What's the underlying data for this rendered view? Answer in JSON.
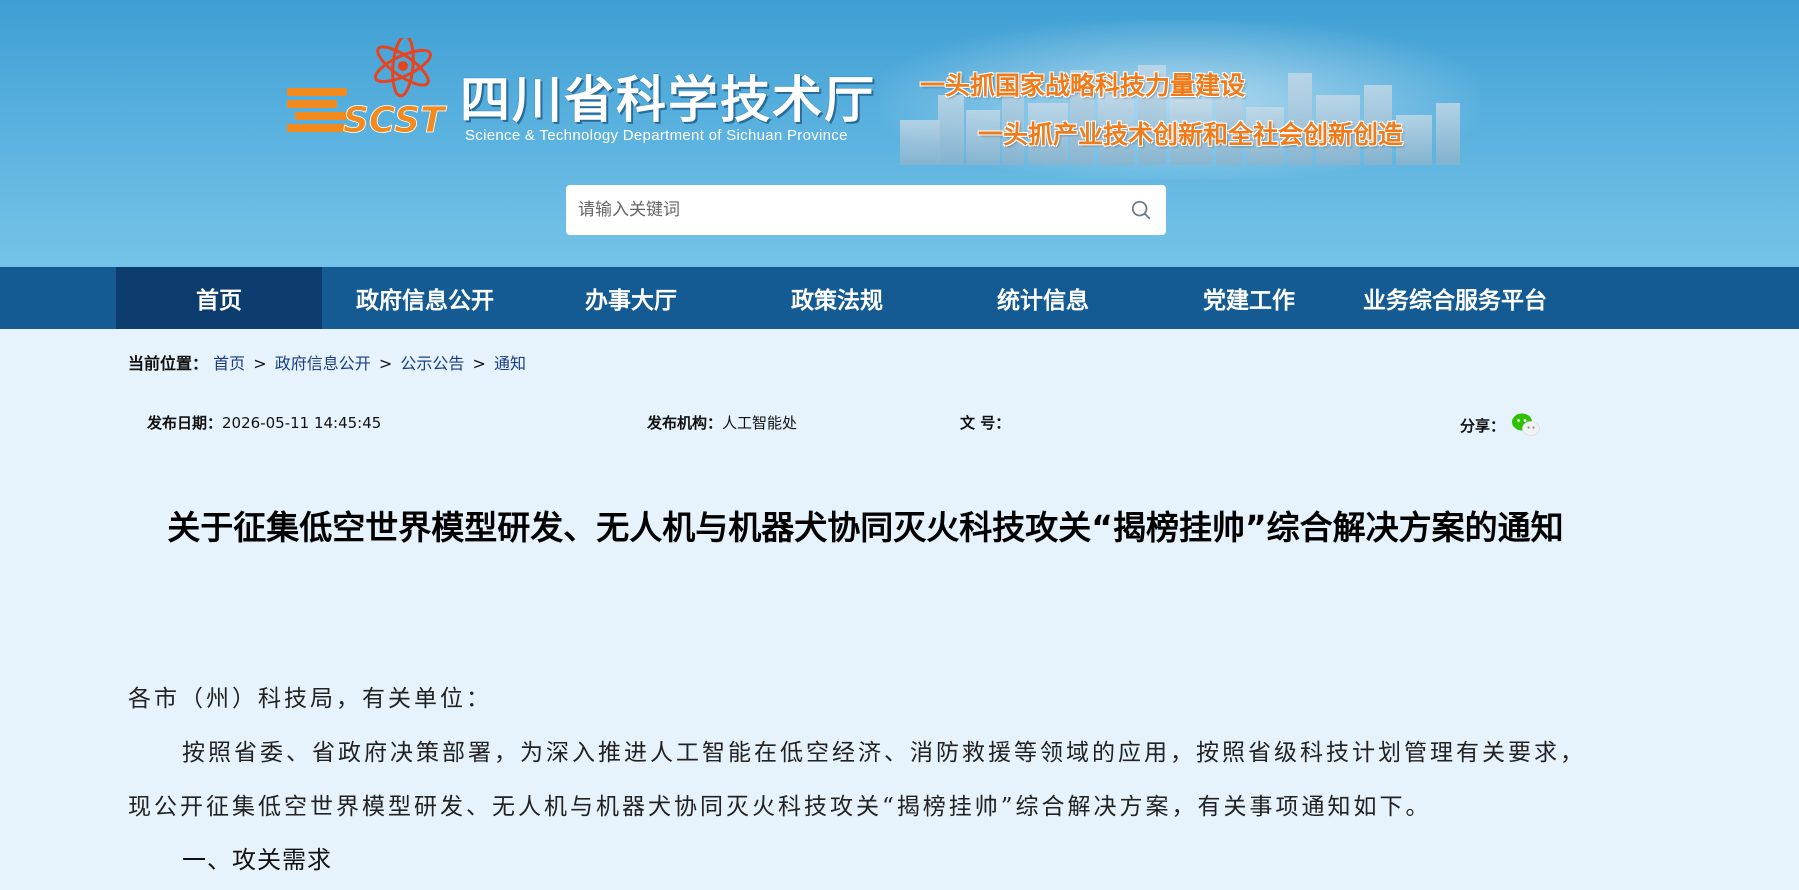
{
  "header": {
    "logo_letters": "SCST",
    "site_name": "四川省科学技术厅",
    "site_name_en": "Science & Technology Department of Sichuan Province",
    "slogan_1": "一头抓国家战略科技力量建设",
    "slogan_2": "一头抓产业技术创新和全社会创新创造"
  },
  "search": {
    "placeholder": "请输入关键词",
    "icon": "search-icon"
  },
  "nav": {
    "items": [
      {
        "label": "首页",
        "active": true
      },
      {
        "label": "政府信息公开"
      },
      {
        "label": "办事大厅"
      },
      {
        "label": "政策法规"
      },
      {
        "label": "统计信息"
      },
      {
        "label": "党建工作"
      },
      {
        "label": "业务综合服务平台"
      }
    ]
  },
  "breadcrumb": {
    "label": "当前位置：",
    "items": [
      "首页",
      "政府信息公开",
      "公示公告",
      "通知"
    ],
    "separator": ">"
  },
  "meta": {
    "date_label": "发布日期：",
    "date_value": "2026-05-11 14:45:45",
    "org_label": "发布机构：",
    "org_value": "人工智能处",
    "doc_no_label": "文 号：",
    "doc_no_value": "",
    "share_label": "分享：",
    "share_icon": "wechat-icon"
  },
  "article": {
    "title": "关于征集低空世界模型研发、无人机与机器犬协同灭火科技攻关“揭榜挂帅”综合解决方案的通知",
    "salutation": "各市（州）科技局，有关单位：",
    "paragraph_1": "按照省委、省政府决策部署，为深入推进人工智能在低空经济、消防救援等领域的应用，按照省级科技计划管理有关要求，现公开征集低空世界模型研发、无人机与机器犬协同灭火科技攻关“揭榜挂帅”综合解决方案，有关事项通知如下。",
    "section_1_heading": "一、攻关需求"
  },
  "colors": {
    "header_blue": "#4aa6d8",
    "nav_bg": "#155b93",
    "nav_active": "#0c3d6e",
    "page_bg": "#e6f2fc",
    "slogan_orange": "#f07b1a",
    "link_blue": "#1a3d84"
  }
}
